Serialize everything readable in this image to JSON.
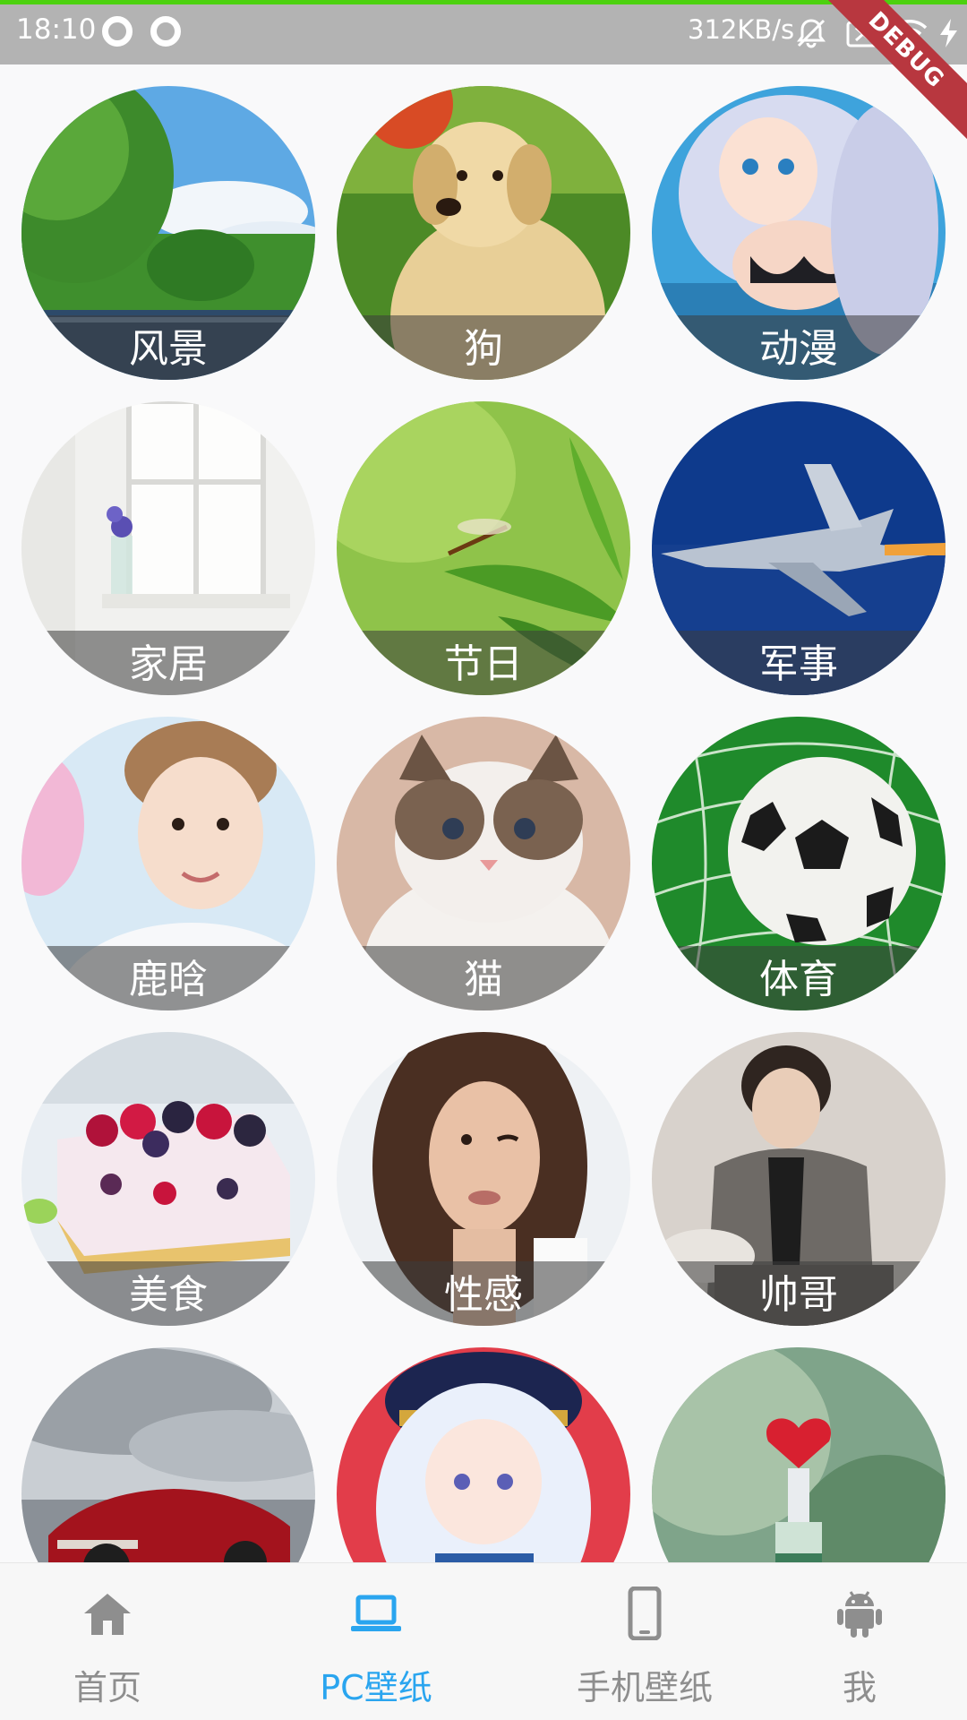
{
  "status_bar": {
    "time": "18:10",
    "network_speed": "312KB/s",
    "icons": [
      "ring-icon",
      "ring-icon",
      "mute-bell-icon",
      "sim-error-icon",
      "wifi-icon",
      "charging-icon"
    ],
    "debug_label": "DEBUG",
    "accent_color": "#4cd10f"
  },
  "categories": [
    {
      "label": "风景",
      "image": "landscape-photo"
    },
    {
      "label": "狗",
      "image": "puppy-photo"
    },
    {
      "label": "动漫",
      "image": "anime-girl-photo"
    },
    {
      "label": "家居",
      "image": "home-window-photo"
    },
    {
      "label": "节日",
      "image": "dragonfly-leaf-photo"
    },
    {
      "label": "军事",
      "image": "fighter-jet-photo"
    },
    {
      "label": "鹿晗",
      "image": "portrait-photo"
    },
    {
      "label": "猫",
      "image": "cat-photo"
    },
    {
      "label": "体育",
      "image": "soccer-ball-photo"
    },
    {
      "label": "美食",
      "image": "berry-cake-photo"
    },
    {
      "label": "性感",
      "image": "woman-portrait-photo"
    },
    {
      "label": "帅哥",
      "image": "man-in-suit-photo"
    },
    {
      "label": "",
      "image": "red-car-photo"
    },
    {
      "label": "",
      "image": "anime-captain-photo"
    },
    {
      "label": "",
      "image": "heart-bottle-photo"
    }
  ],
  "bottom_nav": {
    "items": [
      {
        "label": "首页",
        "icon": "home-icon",
        "active": false
      },
      {
        "label": "PC壁纸",
        "icon": "laptop-icon",
        "active": true
      },
      {
        "label": "手机壁纸",
        "icon": "phone-icon",
        "active": false
      },
      {
        "label": "我",
        "icon": "android-icon",
        "active": false
      }
    ],
    "active_color": "#2aa5ef",
    "inactive_color": "#8e8e8e"
  }
}
